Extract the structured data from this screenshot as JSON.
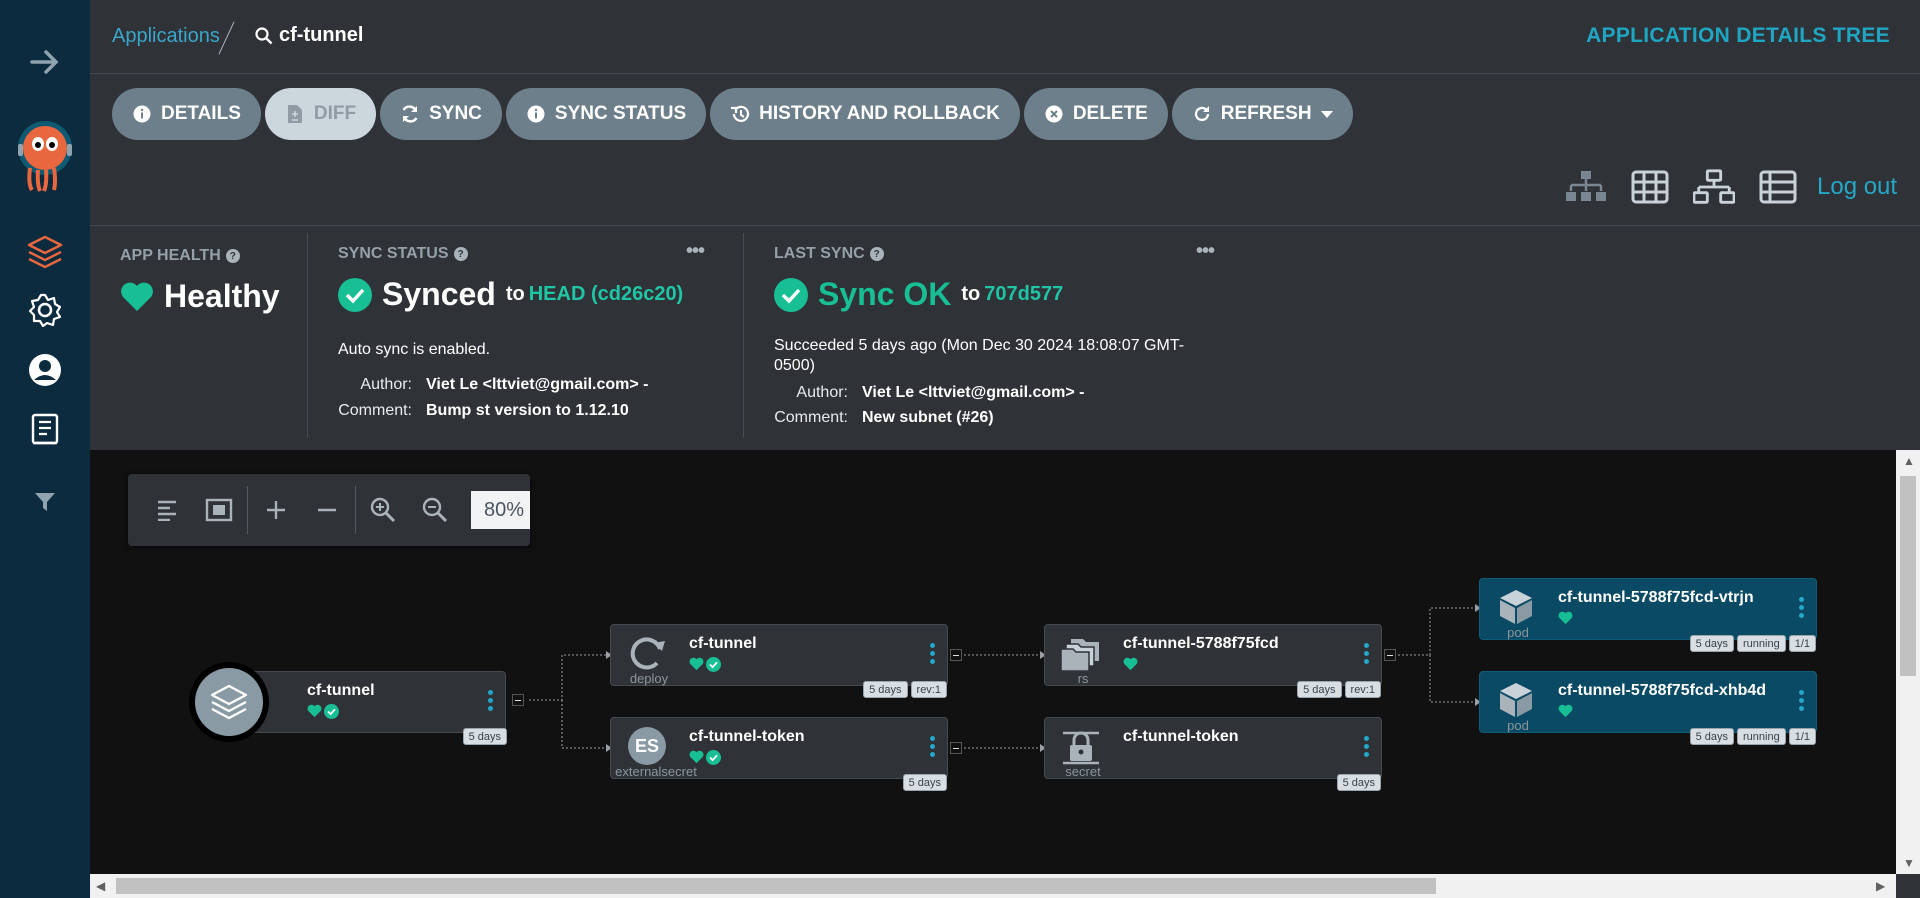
{
  "breadcrumb": {
    "parent": "Applications",
    "current": "cf-tunnel"
  },
  "page_title": "APPLICATION DETAILS TREE",
  "actions": {
    "details": "DETAILS",
    "diff": "DIFF",
    "sync": "SYNC",
    "sync_status": "SYNC STATUS",
    "history": "HISTORY AND ROLLBACK",
    "delete": "DELETE",
    "refresh": "REFRESH"
  },
  "logout": "Log out",
  "app_health": {
    "label": "APP HEALTH",
    "value": "Healthy"
  },
  "sync_status": {
    "label": "SYNC STATUS",
    "value": "Synced",
    "to": "to",
    "revision": "HEAD (cd26c20)",
    "auto_sync": "Auto sync is enabled.",
    "author_label": "Author:",
    "author": "Viet Le <lttviet@gmail.com> -",
    "comment_label": "Comment:",
    "comment": "Bump st version to 1.12.10"
  },
  "last_sync": {
    "label": "LAST SYNC",
    "value": "Sync OK",
    "to": "to",
    "revision": "707d577",
    "succeeded_line1": "Succeeded 5 days ago (Mon Dec 30 2024 18:08:07 GMT-",
    "succeeded_line2": "0500)",
    "author_label": "Author:",
    "author": "Viet Le <lttviet@gmail.com> -",
    "comment_label": "Comment:",
    "comment": "New subnet (#26)"
  },
  "zoom": {
    "level": "80%"
  },
  "nodes": {
    "app": {
      "name": "cf-tunnel",
      "age": "5 days"
    },
    "deploy": {
      "name": "cf-tunnel",
      "kind": "deploy",
      "age": "5 days",
      "rev": "rev:1"
    },
    "externalsecret": {
      "name": "cf-tunnel-token",
      "kind": "externalsecret",
      "icon_text": "ES",
      "age": "5 days"
    },
    "rs": {
      "name": "cf-tunnel-5788f75fcd",
      "kind": "rs",
      "age": "5 days",
      "rev": "rev:1"
    },
    "secret": {
      "name": "cf-tunnel-token",
      "kind": "secret",
      "age": "5 days"
    },
    "pod1": {
      "name": "cf-tunnel-5788f75fcd-vtrjn",
      "kind": "pod",
      "age": "5 days",
      "state": "running",
      "ready": "1/1"
    },
    "pod2": {
      "name": "cf-tunnel-5788f75fcd-xhb4d",
      "kind": "pod",
      "age": "5 days",
      "state": "running",
      "ready": "1/1"
    }
  },
  "colors": {
    "sidebar": "#0d2b3f",
    "accent": "#25a8c8",
    "healthy": "#18be94",
    "pod_bg": "#0b4a65"
  }
}
